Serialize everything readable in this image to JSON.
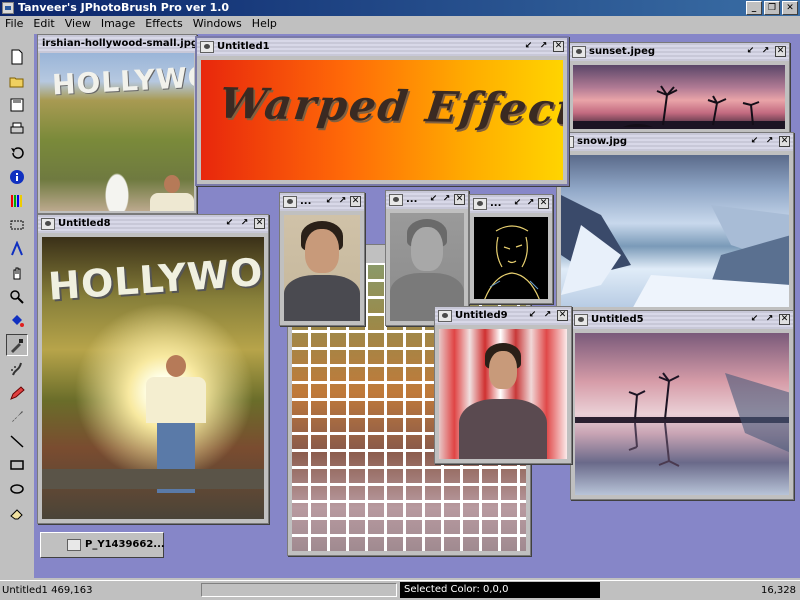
{
  "app": {
    "title": "Tanveer's JPhotoBrush Pro ver 1.0",
    "window_controls": [
      "_",
      "❐",
      "✕"
    ]
  },
  "menu": [
    "File",
    "Edit",
    "View",
    "Image",
    "Effects",
    "Windows",
    "Help"
  ],
  "tools": [
    {
      "name": "new-icon"
    },
    {
      "name": "open-icon"
    },
    {
      "name": "save-icon"
    },
    {
      "name": "print-icon"
    },
    {
      "name": "undo-icon"
    },
    {
      "name": "info-icon"
    },
    {
      "name": "color-bars-icon"
    },
    {
      "name": "select-rect-icon"
    },
    {
      "name": "text-icon"
    },
    {
      "name": "hand-icon"
    },
    {
      "name": "zoom-icon"
    },
    {
      "name": "fill-icon"
    },
    {
      "name": "eyedropper-icon"
    },
    {
      "name": "spray-icon"
    },
    {
      "name": "pencil-icon"
    },
    {
      "name": "brush-icon"
    },
    {
      "name": "line-icon"
    },
    {
      "name": "rectangle-icon"
    },
    {
      "name": "ellipse-icon"
    },
    {
      "name": "eraser-icon"
    }
  ],
  "frames": {
    "hollywood_small": {
      "title": "irshian-hollywood-small.jpg",
      "sign": "HOLLYWOOD"
    },
    "untitled1": {
      "title": "Untitled1",
      "text": "Warped Effects"
    },
    "sunset": {
      "title": "sunset.jpeg"
    },
    "snow": {
      "title": "snow.jpg"
    },
    "untitled8": {
      "title": "Untitled8",
      "sign": "HOLLYWOOD"
    },
    "portrait1": {
      "title": "..."
    },
    "portrait2": {
      "title": "..."
    },
    "portrait3": {
      "title": "..."
    },
    "untitled9": {
      "title": "Untitled9"
    },
    "untitled5": {
      "title": "Untitled5"
    },
    "minimized": {
      "title": "P_Y1439662..."
    }
  },
  "status": {
    "left": "Untitled1 469,163",
    "selected_color": "Selected  Color: 0,0,0",
    "right": "16,328"
  },
  "colors": {
    "desktop": "#8686c8",
    "titlebar": "#0a246a",
    "chrome": "#c0c0c0"
  }
}
